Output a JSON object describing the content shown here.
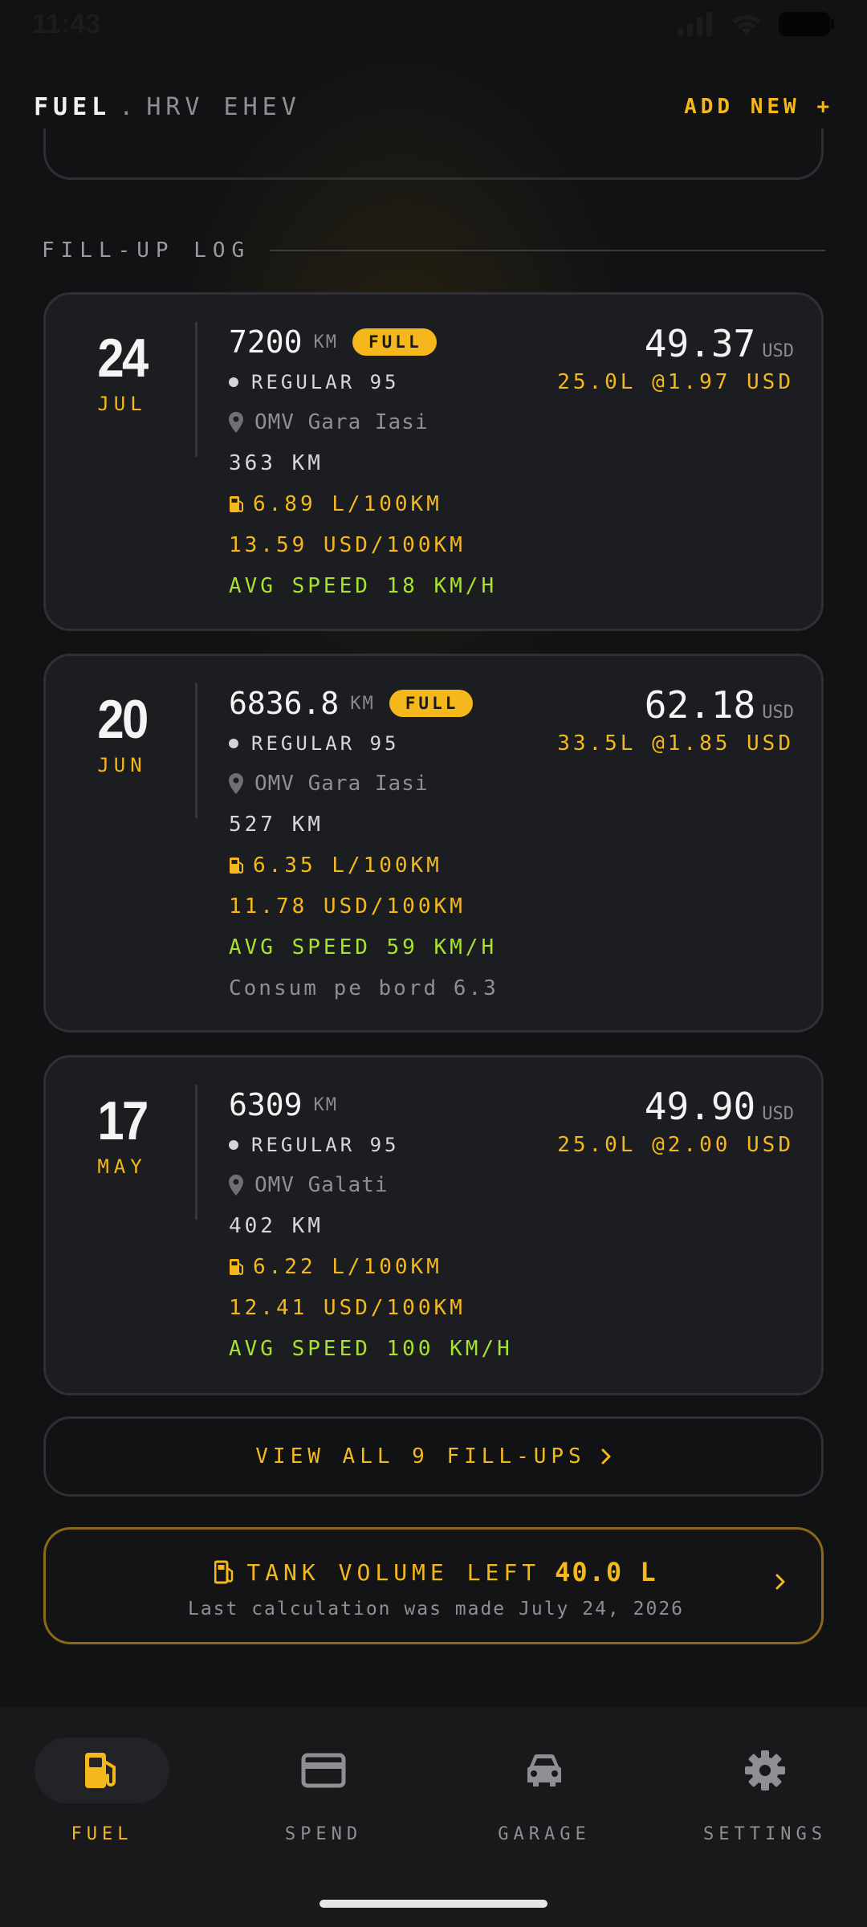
{
  "status_bar": {
    "time": "11:43"
  },
  "header": {
    "title": "FUEL",
    "separator": ".",
    "car_name": "HRV EHEV",
    "add_new_label": "ADD NEW +"
  },
  "section": {
    "label": "FILL-UP LOG"
  },
  "fillups": [
    {
      "day": "24",
      "month": "JUL",
      "odometer": "7200",
      "odometer_unit": "KM",
      "badge": "FULL",
      "fuel_type": "REGULAR 95",
      "station": "OMV Gara Iasi",
      "distance": "363 KM",
      "consumption": "6.89 L/100KM",
      "cost_per_100": "13.59 USD/100KM",
      "avg_speed": "AVG SPEED 18 KM/H",
      "note": "",
      "price": "49.37",
      "currency": "USD",
      "volume_detail": "25.0L @1.97 USD"
    },
    {
      "day": "20",
      "month": "JUN",
      "odometer": "6836.8",
      "odometer_unit": "KM",
      "badge": "FULL",
      "fuel_type": "REGULAR 95",
      "station": "OMV Gara Iasi",
      "distance": "527 KM",
      "consumption": "6.35 L/100KM",
      "cost_per_100": "11.78 USD/100KM",
      "avg_speed": "AVG SPEED 59 KM/H",
      "note": "Consum pe bord 6.3",
      "price": "62.18",
      "currency": "USD",
      "volume_detail": "33.5L @1.85 USD"
    },
    {
      "day": "17",
      "month": "MAY",
      "odometer": "6309",
      "odometer_unit": "KM",
      "badge": "",
      "fuel_type": "REGULAR 95",
      "station": "OMV Galati",
      "distance": "402 KM",
      "consumption": "6.22 L/100KM",
      "cost_per_100": "12.41 USD/100KM",
      "avg_speed": "AVG SPEED 100 KM/H",
      "note": "",
      "price": "49.90",
      "currency": "USD",
      "volume_detail": "25.0L @2.00 USD"
    }
  ],
  "view_all": {
    "label": "VIEW ALL 9 FILL-UPS"
  },
  "tank": {
    "label": "TANK VOLUME LEFT",
    "value": "40.0 L",
    "subtitle": "Last calculation was made July 24, 2026"
  },
  "nav": {
    "items": [
      {
        "label": "FUEL",
        "icon": "fuel-pump-icon",
        "active": true
      },
      {
        "label": "SPEND",
        "icon": "credit-card-icon",
        "active": false
      },
      {
        "label": "GARAGE",
        "icon": "car-icon",
        "active": false
      },
      {
        "label": "SETTINGS",
        "icon": "gear-icon",
        "active": false
      }
    ]
  },
  "colors": {
    "accent": "#f5b81c",
    "speed_green": "#a6e22e",
    "background": "#111214",
    "card": "#1c1d20"
  }
}
